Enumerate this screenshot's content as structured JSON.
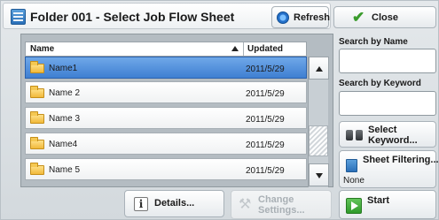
{
  "window": {
    "title": "Folder 001 - Select Job Flow Sheet",
    "icon": "job-flow-sheet-icon"
  },
  "toolbar": {
    "refresh_label": "Refresh",
    "close_label": "Close"
  },
  "list": {
    "columns": {
      "name": "Name",
      "updated": "Updated"
    },
    "sort": "ascending",
    "rows": [
      {
        "name": "Name1",
        "updated": "2011/5/29",
        "selected": true
      },
      {
        "name": "Name 2",
        "updated": "2011/5/29",
        "selected": false
      },
      {
        "name": "Name 3",
        "updated": "2011/5/29",
        "selected": false
      },
      {
        "name": "Name4",
        "updated": "2011/5/29",
        "selected": false
      },
      {
        "name": "Name 5",
        "updated": "2011/5/29",
        "selected": false
      }
    ]
  },
  "actions": {
    "details_label": "Details...",
    "change_settings_label": "Change Settings..."
  },
  "side": {
    "search_by_name_label": "Search by Name",
    "search_by_name_value": "",
    "search_by_keyword_label": "Search by Keyword",
    "search_by_keyword_value": "",
    "select_keyword_label": "Select Keyword...",
    "sheet_filtering_label": "Sheet Filtering...",
    "sheet_filtering_value": "None",
    "start_label": "Start"
  },
  "colors": {
    "selected_row": "#4f8fdc",
    "background": "#dde2e6",
    "start_icon": "#3aa832"
  }
}
